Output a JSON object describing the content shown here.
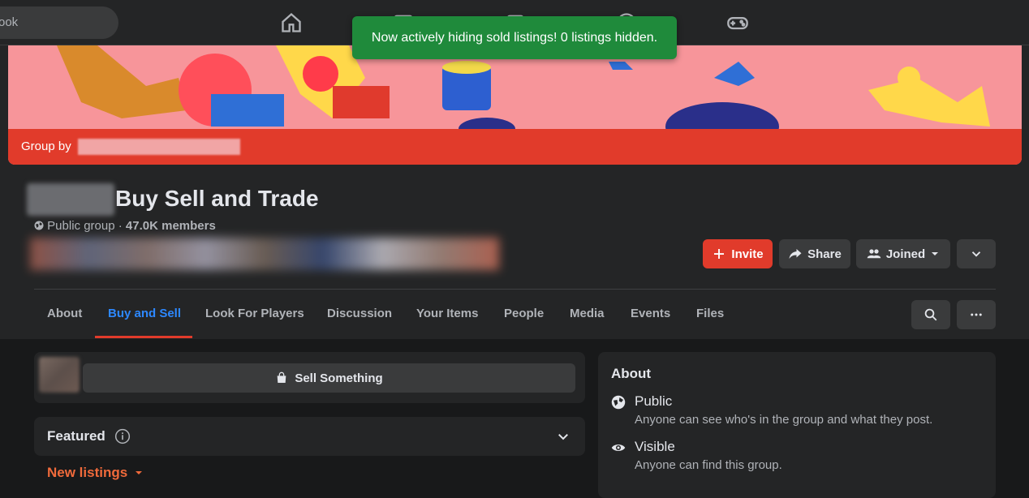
{
  "topbar": {
    "search_partial": "ook",
    "nav_icons": [
      "home-icon",
      "video-icon",
      "marketplace-icon",
      "groups-icon",
      "gaming-icon"
    ]
  },
  "toast": {
    "message": "Now actively hiding sold listings! 0 listings hidden."
  },
  "cover": {
    "group_by_label": "Group by"
  },
  "group": {
    "title": "Buy Sell and Trade",
    "privacy": "Public group",
    "members": "47.0K members"
  },
  "actions": {
    "invite": "Invite",
    "share": "Share",
    "joined": "Joined"
  },
  "tabs": [
    {
      "label": "About"
    },
    {
      "label": "Buy and Sell"
    },
    {
      "label": "Look For Players"
    },
    {
      "label": "Discussion"
    },
    {
      "label": "Your Items"
    },
    {
      "label": "People"
    },
    {
      "label": "Media"
    },
    {
      "label": "Events"
    },
    {
      "label": "Files"
    }
  ],
  "active_tab_index": 1,
  "sell": {
    "label": "Sell Something"
  },
  "featured": {
    "title": "Featured"
  },
  "listings": {
    "filter_label": "New listings"
  },
  "about": {
    "title": "About",
    "items": [
      {
        "label": "Public",
        "desc": "Anyone can see who's in the group and what they post.",
        "icon": "globe-icon"
      },
      {
        "label": "Visible",
        "desc": "Anyone can find this group.",
        "icon": "eye-icon"
      }
    ]
  },
  "colors": {
    "accent_red": "#e13b2b",
    "active_tab_blue": "#2d88ff",
    "toast_green": "#1f8a3b",
    "new_listings_orange": "#f06a3b"
  }
}
